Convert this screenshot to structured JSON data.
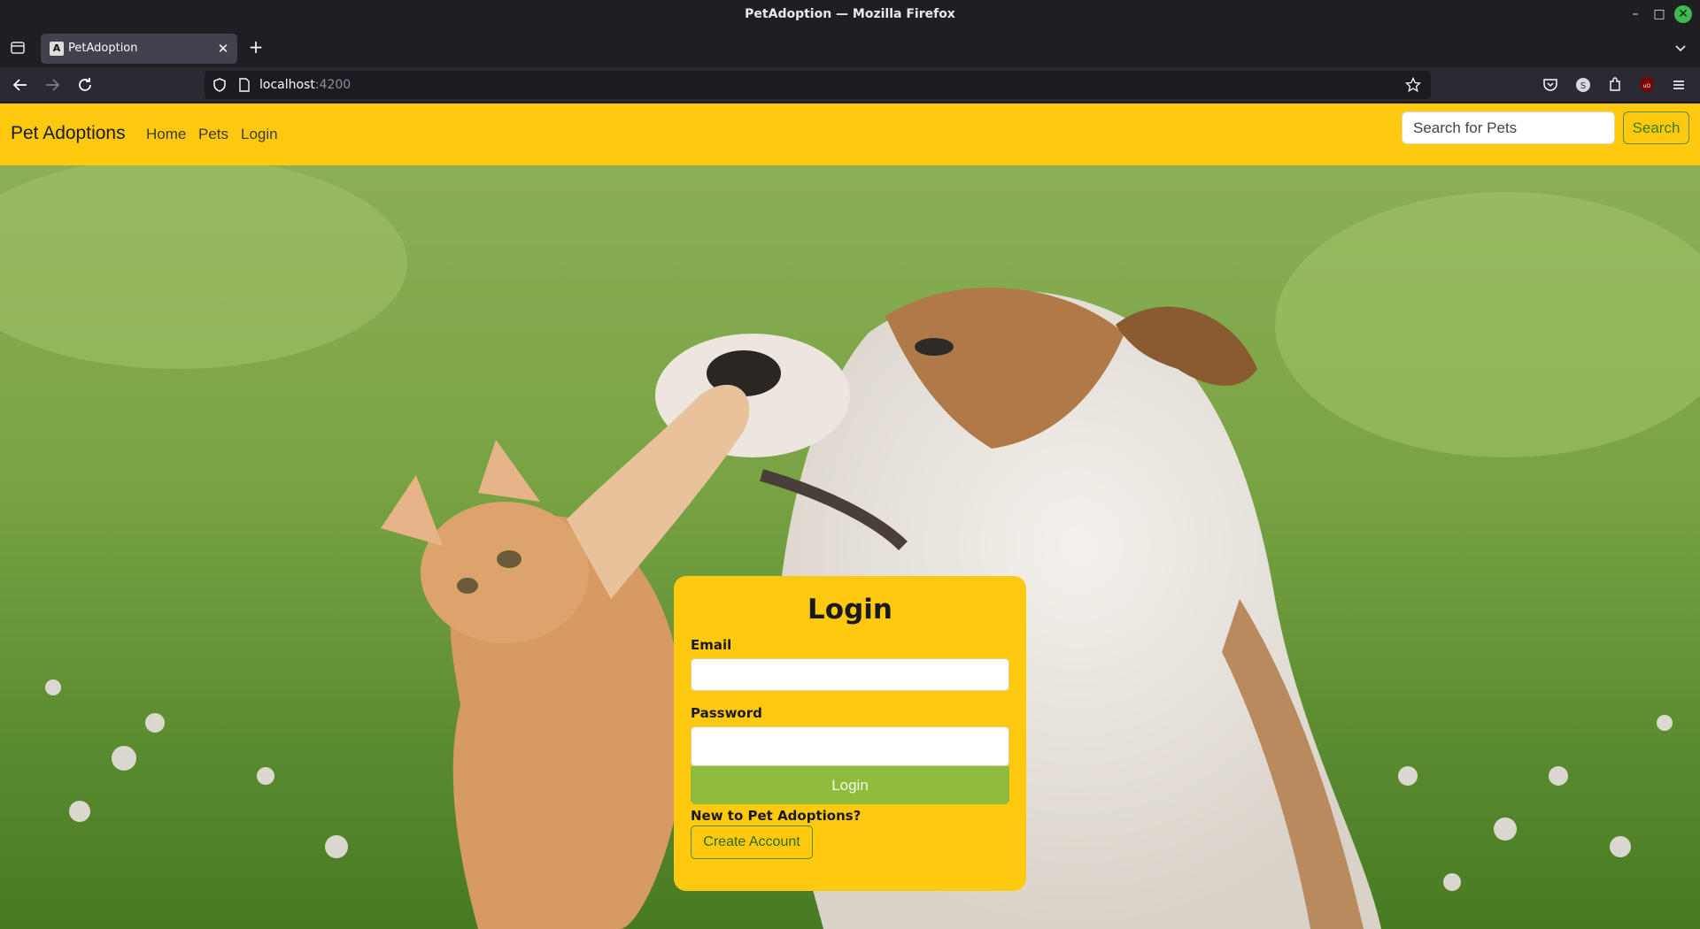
{
  "window": {
    "title": "PetAdoption — Mozilla Firefox"
  },
  "browser": {
    "tab_title": "PetAdoption",
    "tab_favicon_letter": "A",
    "url_host": "localhost",
    "url_port": ":4200",
    "close_glyph": "✕",
    "new_tab_glyph": "+",
    "minimize_glyph": "–",
    "maximize_glyph": "□",
    "icons": [
      "tab-list-icon",
      "back-icon",
      "forward-icon",
      "reload-icon",
      "shield-icon",
      "page-icon",
      "bookmark-star-icon",
      "pocket-icon",
      "account-icon",
      "extensions-icon",
      "ublock-icon",
      "menu-icon",
      "tab-overflow-icon"
    ]
  },
  "header": {
    "brand": "Pet Adoptions",
    "nav": {
      "home": "Home",
      "pets": "Pets",
      "login": "Login"
    },
    "search_placeholder": "Search for Pets",
    "search_button": "Search",
    "background_color": "#ffc90f"
  },
  "login_form": {
    "title": "Login",
    "email_label": "Email",
    "email_value": "",
    "password_label": "Password",
    "password_value": "",
    "submit_label": "Login",
    "new_user_text": "New to Pet Adoptions?",
    "create_account_label": "Create Account",
    "submit_color": "#8fbc3c"
  }
}
